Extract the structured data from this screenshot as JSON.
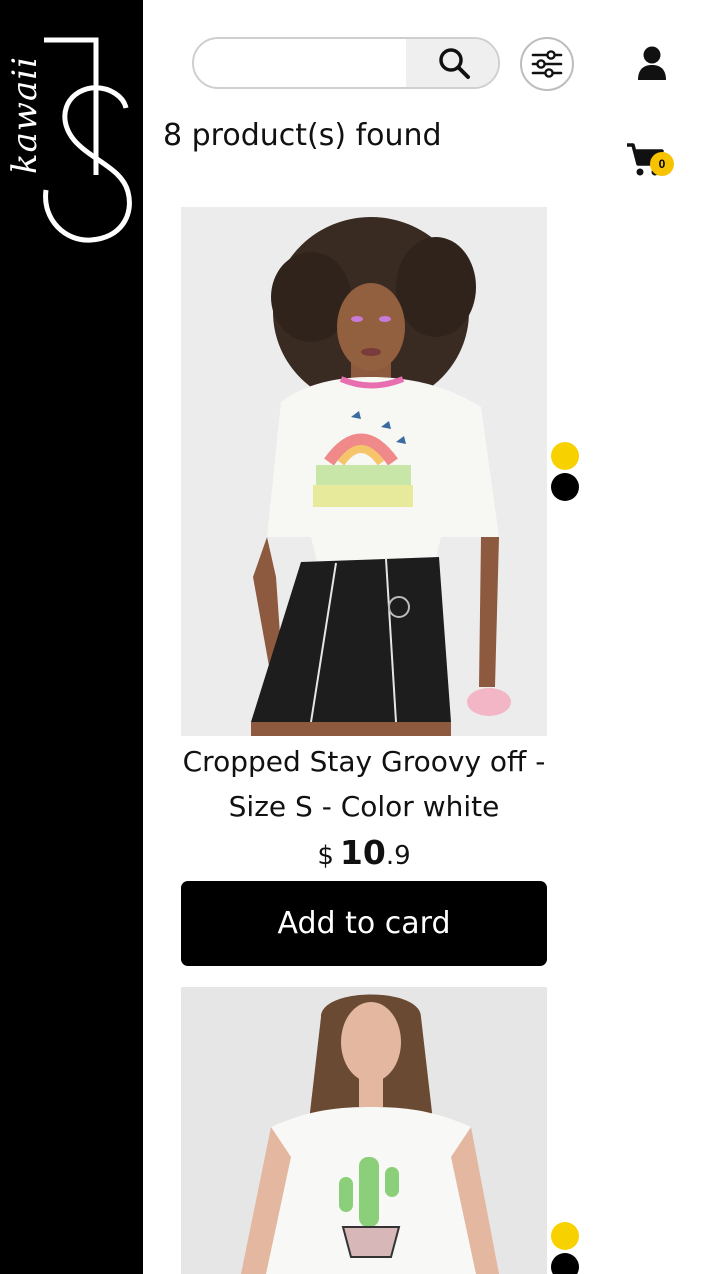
{
  "brand": {
    "script": "kawaii",
    "accent": "#f7c300"
  },
  "search": {
    "placeholder": "",
    "value": "",
    "icon": "search-icon"
  },
  "header": {
    "filter_icon": "sliders-icon",
    "user_icon": "user-icon"
  },
  "cart": {
    "icon": "cart-icon",
    "count": "0"
  },
  "results": {
    "found_text": "8 product(s) found"
  },
  "products": [
    {
      "name_line1": "Cropped Stay Groovy off -",
      "name_line2": "Size S - Color white",
      "price": {
        "currency": "$",
        "integer": "10",
        "decimal": ".9"
      },
      "button_label": "Add to card",
      "swatches": [
        "#f7d200",
        "#000000"
      ]
    },
    {
      "name_line1": "",
      "name_line2": "",
      "price": {
        "currency": "",
        "integer": "",
        "decimal": ""
      },
      "button_label": "",
      "swatches": [
        "#f7d200",
        "#000000"
      ]
    }
  ]
}
